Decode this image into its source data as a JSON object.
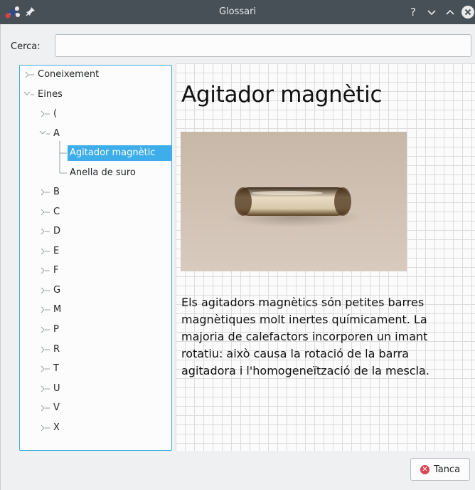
{
  "window": {
    "title": "Glossari"
  },
  "search": {
    "label": "Cerca:",
    "value": "",
    "placeholder": ""
  },
  "tree": {
    "items": [
      {
        "label": "Coneixement",
        "expanded": false
      },
      {
        "label": "Eines",
        "expanded": true
      },
      {
        "label": "(",
        "expanded": false
      },
      {
        "label": "A",
        "expanded": true
      },
      {
        "label": "Agitador magnètic",
        "selected": true
      },
      {
        "label": "Anella de suro"
      },
      {
        "label": "B",
        "expanded": false
      },
      {
        "label": "C",
        "expanded": false
      },
      {
        "label": "D",
        "expanded": false
      },
      {
        "label": "E",
        "expanded": false
      },
      {
        "label": "F",
        "expanded": false
      },
      {
        "label": "G",
        "expanded": false
      },
      {
        "label": "M",
        "expanded": false
      },
      {
        "label": "P",
        "expanded": false
      },
      {
        "label": "R",
        "expanded": false
      },
      {
        "label": "T",
        "expanded": false
      },
      {
        "label": "U",
        "expanded": false
      },
      {
        "label": "V",
        "expanded": false
      },
      {
        "label": "X",
        "expanded": false
      }
    ]
  },
  "entry": {
    "title": "Agitador magnètic",
    "description": "Els agitadors magnètics són petites barres magnètiques molt inertes químicament. La majoria de calefactors incorporen un imant rotatiu: això causa la rotació de la barra agitadora i l'homogeneïtzació de la mescla."
  },
  "buttons": {
    "close_label": "Tanca"
  },
  "colors": {
    "titlebar": "#475057",
    "selection": "#3daee9",
    "close_icon": "#da4453"
  }
}
